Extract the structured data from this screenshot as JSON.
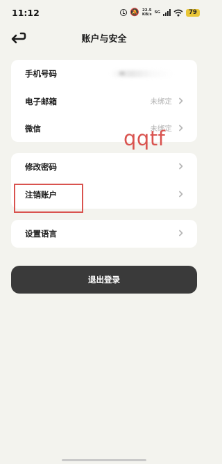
{
  "status_bar": {
    "time": "11:12",
    "net_speed_value": "22.5",
    "net_speed_unit": "KB/s",
    "network_type": "5G",
    "battery": "79",
    "battery_color": "#e9c637"
  },
  "header": {
    "title": "账户与安全"
  },
  "sections": [
    {
      "items": [
        {
          "label": "手机号码",
          "value": ""
        },
        {
          "label": "电子邮箱",
          "value": "未绑定"
        },
        {
          "label": "微信",
          "value": "未绑定"
        }
      ]
    },
    {
      "items": [
        {
          "label": "修改密码"
        },
        {
          "label": "注销账户"
        }
      ]
    },
    {
      "items": [
        {
          "label": "设置语言"
        }
      ]
    }
  ],
  "logout": {
    "label": "退出登录"
  },
  "annotation": {
    "text": "qqtf",
    "color": "#d9534f"
  },
  "colors": {
    "background": "#f3f3ee",
    "card": "#ffffff",
    "button": "#3a3a3a"
  }
}
